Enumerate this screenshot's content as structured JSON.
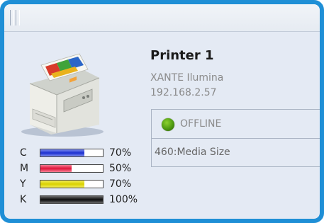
{
  "printer": {
    "name": "Printer 1",
    "model": "XANTE Ilumina",
    "ip": "192.168.2.57",
    "status": "OFFLINE",
    "status_color": "#4f9a12",
    "status_code": "460:Media Size"
  },
  "ink": [
    {
      "letter": "C",
      "percent_label": "70%",
      "level": 0.7,
      "color_start": "#1b2fd0",
      "color_end": "#7f8ff0"
    },
    {
      "letter": "M",
      "percent_label": "50%",
      "level": 0.5,
      "color_start": "#e0153a",
      "color_end": "#f47e94"
    },
    {
      "letter": "Y",
      "percent_label": "70%",
      "level": 0.7,
      "color_start": "#d9d100",
      "color_end": "#f4ee5a"
    },
    {
      "letter": "K",
      "percent_label": "100%",
      "level": 1.0,
      "color_start": "#0c0c0c",
      "color_end": "#6a6a6a"
    }
  ],
  "colors": {
    "frame": "#1f8fd6",
    "panel": "#e4eaf4"
  }
}
